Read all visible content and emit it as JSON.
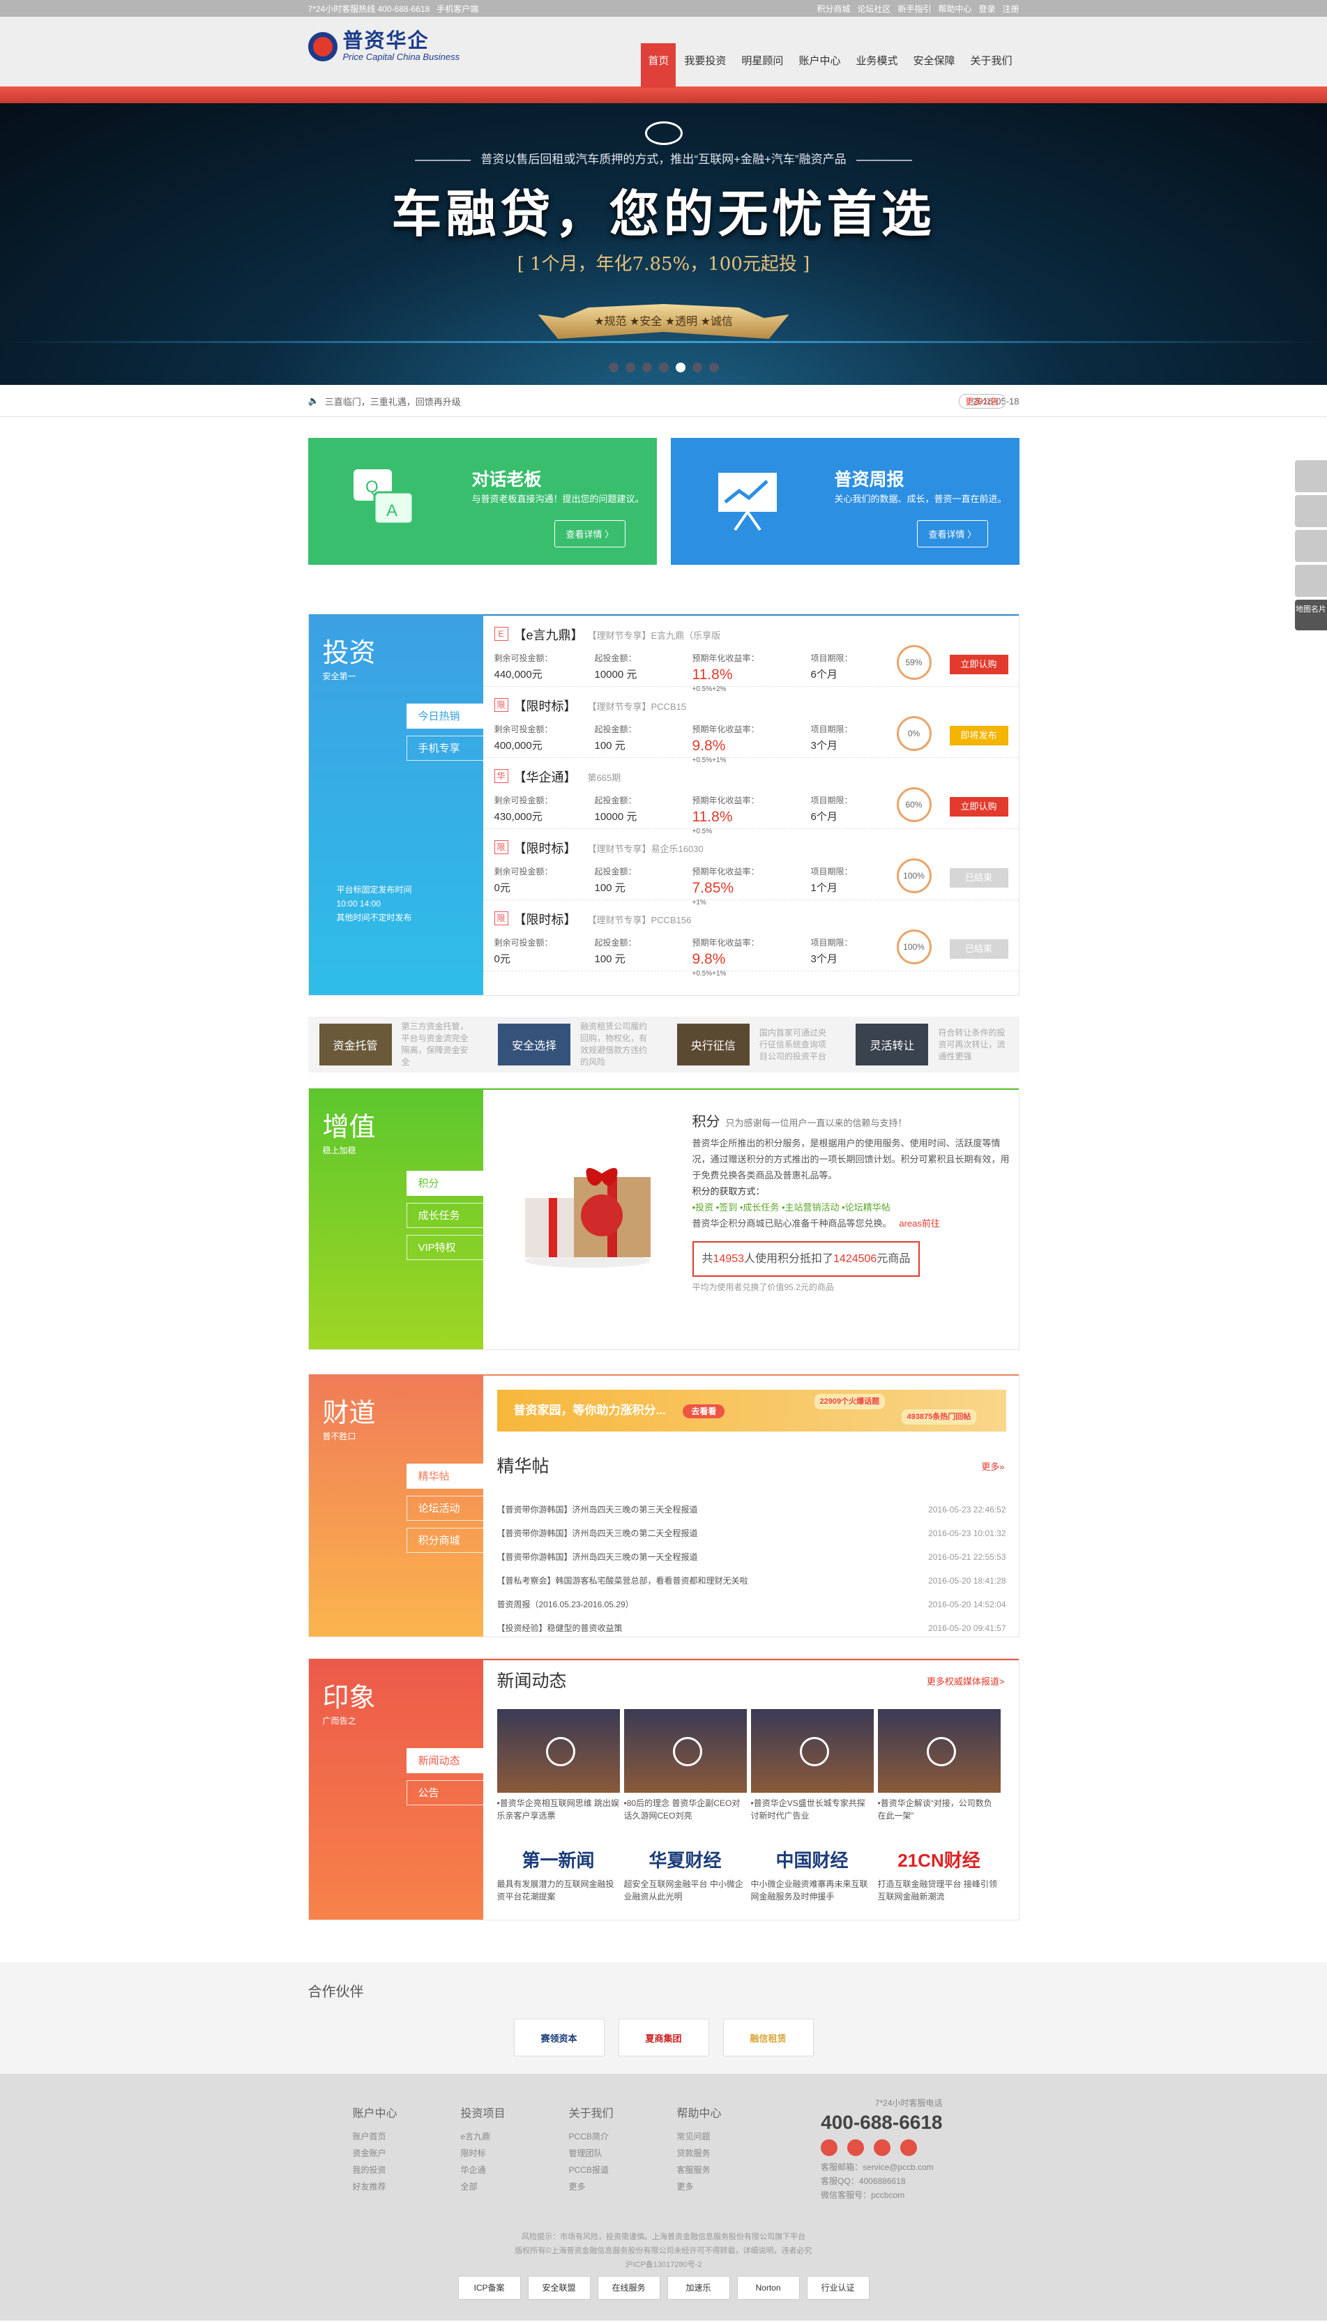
{
  "topbar": {
    "hotline": "7*24小时客服热线 400-688-6618",
    "app": "手机客户端",
    "links": [
      "积分商城",
      "论坛社区",
      "新手指引",
      "帮助中心",
      "登录",
      "注册"
    ]
  },
  "logo": {
    "cn": "普资华企",
    "en": "Price Capital China Business"
  },
  "nav": [
    "首页",
    "我要投资",
    "明星顾问",
    "账户中心",
    "业务模式",
    "安全保障",
    "关于我们"
  ],
  "banner": {
    "line1": "普资以售后回租或汽车质押的方式，推出“互联网+金融+汽车”融资产品",
    "title": "车融贷，您的无忧首选",
    "sub": "[ 1个月，年化7.85%，100元起投 ]",
    "ribbon": "★规范 ★安全 ★透明 ★诚信"
  },
  "notice": {
    "text": "三喜临门，三重礼遇，回馈再升级",
    "date": "2016-05-18",
    "more": "更多公告"
  },
  "promo": [
    {
      "title": "对话老板",
      "desc": "与普资老板直接沟通！提出您的问题建议。",
      "btn": "查看详情 〉"
    },
    {
      "title": "普资周报",
      "desc": "关心我们的数据、成长，普资一直在前进。",
      "btn": "查看详情 〉"
    }
  ],
  "invest": {
    "title": "投资",
    "sub": "安全第一",
    "tabs": [
      "今日热销",
      "手机专享"
    ],
    "note": "平台标固定发布时间\n10:00 14:00\n其他时间不定时发布",
    "labels": [
      "剩余可投金额：",
      "起投金额：",
      "预期年化收益率：",
      "项目期限："
    ],
    "products": [
      {
        "tag": "E",
        "name": "【e言九鼎】",
        "sub": "【理财节专享】E言九鼎（乐享版",
        "remain": "440,000元",
        "min": "10000 元",
        "rate": "11.8%",
        "bonus": "+0.5%+2%",
        "term": "6个月",
        "pct": "59%",
        "btn": "立即认购",
        "color": "#e23a2c"
      },
      {
        "tag": "限",
        "name": "【限时标】",
        "sub": "【理财节专享】PCCB15",
        "remain": "400,000元",
        "min": "100 元",
        "rate": "9.8%",
        "bonus": "+0.5%+1%",
        "term": "3个月",
        "pct": "0%",
        "btn": "即将发布",
        "color": "#f5b400"
      },
      {
        "tag": "华",
        "name": "【华企通】",
        "sub": "第665期",
        "remain": "430,000元",
        "min": "10000 元",
        "rate": "11.8%",
        "bonus": "+0.5%",
        "term": "6个月",
        "pct": "60%",
        "btn": "立即认购",
        "color": "#e23a2c"
      },
      {
        "tag": "限",
        "name": "【限时标】",
        "sub": "【理财节专享】易企乐16030",
        "remain": "0元",
        "min": "100 元",
        "rate": "7.85%",
        "bonus": "+1%",
        "term": "1个月",
        "pct": "100%",
        "btn": "已结束",
        "color": "#d6d6d6"
      },
      {
        "tag": "限",
        "name": "【限时标】",
        "sub": "【理财节专享】PCCB156",
        "remain": "0元",
        "min": "100 元",
        "rate": "9.8%",
        "bonus": "+0.5%+1%",
        "term": "3个月",
        "pct": "100%",
        "btn": "已结束",
        "color": "#d6d6d6"
      }
    ]
  },
  "features": [
    {
      "img": "资金托管",
      "desc": "第三方资金托管，平台与资金流完全隔离，保障资金安全",
      "color": "#6a5a3a"
    },
    {
      "img": "安全选择",
      "desc": "融资租赁公司履约回购，物权化，有效规避借款方违约的风险",
      "color": "#34527a"
    },
    {
      "img": "央行征信",
      "desc": "国内首家可通过央行征信系统查询项目公司的投资平台",
      "color": "#5b4a32"
    },
    {
      "img": "灵活转让",
      "desc": "符合转让条件的投资可再次转让，流通性更强",
      "color": "#39424d"
    }
  ],
  "zengzhi": {
    "title": "增值",
    "sub": "稳上加稳",
    "tabs": [
      "积分",
      "成长任务",
      "VIP特权"
    ],
    "jf_title": "积分",
    "jf_sub": "只为感谢每一位用户一直以来的信赖与支持！",
    "jf_desc": "普资华企所推出的积分服务，是根据用户的使用服务、使用时间、活跃度等情况，通过赠送积分的方式推出的一项长期回馈计划。积分可累积且长期有效，用于免费兑换各类商品及普惠礼品等。",
    "jf_how": "积分的获取方式：",
    "jf_ways": "•投资  •签到  •成长任务  •主站营销活动  •论坛精华帖",
    "jf_note": "普资华企积分商城已贴心准备千种商品等您兑换。",
    "jf_link": "areas前往",
    "stat_pre": "共",
    "stat_n": "14953",
    "stat_mid": "人使用积分抵扣了",
    "stat_v": "1424506",
    "stat_suf": "元商品",
    "stat_foot": "平均为使用者兑换了价值95.2元的商品"
  },
  "caidao": {
    "title": "财道",
    "sub": "普不胜口",
    "tabs": [
      "精华帖",
      "论坛活动",
      "积分商城"
    ],
    "banner": "普资家园，等你助力涨积分...",
    "banner_btn": "去看看",
    "b1": "22909个火爆话题",
    "b2": "493875条热门回帖",
    "ptitle": "精华帖",
    "more": "更多»",
    "posts": [
      [
        "【普资带你游韩国】济州岛四天三晚の第三天全程报道",
        "2016-05-23 22:46:52"
      ],
      [
        "【普资带你游韩国】济州岛四天三晚の第二天全程报道",
        "2016-05-23 10:01:32"
      ],
      [
        "【普资带你游韩国】济州岛四天三晚の第一天全程报道",
        "2016-05-21 22:55:53"
      ],
      [
        "【普私考察会】韩国游客私宅酸菜营总部，看看普资都和理财无关啦",
        "2016-05-20 18:41:28"
      ],
      [
        "普资周报（2016.05.23-2016.05.29）",
        "2016-05-20 14:52:04"
      ],
      [
        "【投资经验】稳健型的普资收益策",
        "2016-05-20 09:41:57"
      ]
    ]
  },
  "yinxiang": {
    "title": "印象",
    "sub": "广而告之",
    "tabs": [
      "新闻动态",
      "公告"
    ],
    "ntitle": "新闻动态",
    "more": "更多权威媒体报道>",
    "videos": [
      "•普资华企亮相互联网思维 跳出娱乐亲客户享选票",
      "•80后的理念 普资华企副CEO对话久游网CEO刘亮",
      "•普资华企VS盛世长城专家共探讨新时代广告业",
      "•普资华企解谈“对接，公司数负在此一架”"
    ],
    "media": [
      {
        "logo": "第一新闻",
        "desc": "最具有发展潜力的互联网金融投资平台花潮提案"
      },
      {
        "logo": "华夏财经",
        "desc": "超安全互联网金融平台 中小微企业融资从此光明"
      },
      {
        "logo": "中国财经",
        "desc": "中小微企业融资难寨再未来互联网金融服务及时伸援手"
      },
      {
        "logo": "21CN财经",
        "desc": "打造互联金融贷理平台 接峰引领互联网金融新潮流"
      }
    ]
  },
  "partner": {
    "title": "合作伙伴",
    "items": [
      "赛领资本",
      "夏商集团",
      "融信租赁"
    ]
  },
  "footer": {
    "cols": [
      {
        "h": "账户中心",
        "items": [
          "账户首页",
          "资金账户",
          "我的投资",
          "好友推荐"
        ]
      },
      {
        "h": "投资项目",
        "items": [
          "e言九鼎",
          "限时标",
          "华企通",
          "全部"
        ]
      },
      {
        "h": "关于我们",
        "items": [
          "PCCB简介",
          "管理团队",
          "PCCB报道",
          "更多"
        ]
      },
      {
        "h": "帮助中心",
        "items": [
          "常见问题",
          "贷款服务",
          "客服服务",
          "更多"
        ]
      }
    ],
    "hot": "7*24小时客服电话",
    "tel": "400-688-6618",
    "email": "客服邮箱：service@pccb.com",
    "qq": "客服QQ：4006886618",
    "wx": "微信客服号：pccbcom",
    "l1": "风险提示：市场有风险，投资需谨慎。上海普资金融信息服务股份有限公司旗下平台",
    "l2": "版权所有©上海普资金融信息服务股份有限公司未经许可不得转载，详细说明，违者必究",
    "l3": "沪ICP备13017280号-2",
    "badges": [
      "ICP备案",
      "安全联盟",
      "在线服务",
      "加速乐",
      "Norton",
      "行业认证"
    ]
  },
  "float": {
    "map": "地图名片"
  }
}
